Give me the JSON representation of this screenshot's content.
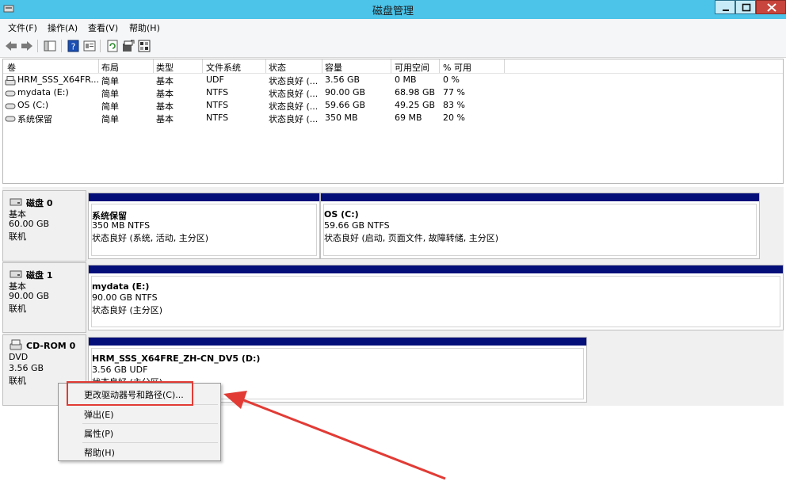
{
  "window": {
    "title": "磁盘管理"
  },
  "menubar": {
    "items": [
      "文件(F)",
      "操作(A)",
      "查看(V)",
      "帮助(H)"
    ]
  },
  "toolbar": {
    "icons": [
      "back-arrow-icon",
      "forward-arrow-icon",
      "console-tree-icon",
      "help-icon",
      "properties-icon",
      "refresh-icon",
      "export-icon",
      "settings-icon"
    ]
  },
  "volume_list": {
    "columns": [
      "卷",
      "布局",
      "类型",
      "文件系统",
      "状态",
      "容量",
      "可用空间",
      "% 可用"
    ],
    "rows": [
      {
        "name": "HRM_SSS_X64FR...",
        "layout": "简单",
        "type": "基本",
        "fs": "UDF",
        "status": "状态良好 (...",
        "capacity": "3.56 GB",
        "free": "0 MB",
        "pct": "0 %"
      },
      {
        "name": "mydata (E:)",
        "layout": "简单",
        "type": "基本",
        "fs": "NTFS",
        "status": "状态良好 (...",
        "capacity": "90.00 GB",
        "free": "68.98 GB",
        "pct": "77 %"
      },
      {
        "name": "OS (C:)",
        "layout": "简单",
        "type": "基本",
        "fs": "NTFS",
        "status": "状态良好 (...",
        "capacity": "59.66 GB",
        "free": "49.25 GB",
        "pct": "83 %"
      },
      {
        "name": "系统保留",
        "layout": "简单",
        "type": "基本",
        "fs": "NTFS",
        "status": "状态良好 (...",
        "capacity": "350 MB",
        "free": "69 MB",
        "pct": "20 %"
      }
    ]
  },
  "disks": [
    {
      "name": "磁盘 0",
      "type": "基本",
      "size": "60.00 GB",
      "state": "联机",
      "partitions": [
        {
          "name": "系统保留",
          "size_fs": "350 MB NTFS",
          "status": "状态良好 (系统, 活动, 主分区)"
        },
        {
          "name": "OS  (C:)",
          "size_fs": "59.66 GB NTFS",
          "status": "状态良好 (启动, 页面文件, 故障转储, 主分区)"
        }
      ]
    },
    {
      "name": "磁盘 1",
      "type": "基本",
      "size": "90.00 GB",
      "state": "联机",
      "partitions": [
        {
          "name": "mydata  (E:)",
          "size_fs": "90.00 GB NTFS",
          "status": "状态良好 (主分区)"
        }
      ]
    },
    {
      "name": "CD-ROM 0",
      "type": "DVD",
      "size": "3.56 GB",
      "state": "联机",
      "partitions": [
        {
          "name": "HRM_SSS_X64FRE_ZH-CN_DV5  (D:)",
          "size_fs": "3.56 GB UDF",
          "status": "状态良好 (主分区)"
        }
      ]
    }
  ],
  "context_menu": {
    "items": [
      "更改驱动器号和路径(C)...",
      "弹出(E)",
      "属性(P)",
      "帮助(H)"
    ]
  },
  "colors": {
    "titlebar": "#4cc3e8",
    "partition_bar": "#050f7a",
    "annotation": "#e23b35"
  }
}
